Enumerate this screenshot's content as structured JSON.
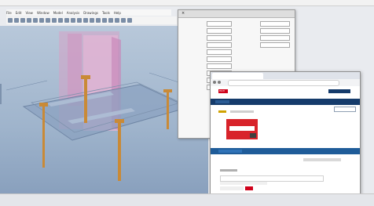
{
  "app": {
    "menu": [
      "File",
      "Edit",
      "View",
      "Window",
      "Model",
      "Analysis",
      "Drawings",
      "Tools",
      "Help"
    ],
    "status_items": [
      "",
      "",
      ""
    ]
  },
  "panel": {
    "title": "",
    "fields": [
      "",
      "",
      "",
      "",
      "",
      "",
      "",
      "",
      "",
      "",
      "",
      "",
      "",
      ""
    ]
  },
  "browser": {
    "tab_title": "",
    "url": "",
    "brand": "HILTI"
  },
  "colors": {
    "viewport_bg": "#9fb4cc",
    "pink_slab": "#d6a3c7",
    "grid_plane": "#8aa1c0",
    "anchor_orange": "#c98a37",
    "hilti_red": "#d8232a",
    "site_nav": "#153b6b"
  }
}
